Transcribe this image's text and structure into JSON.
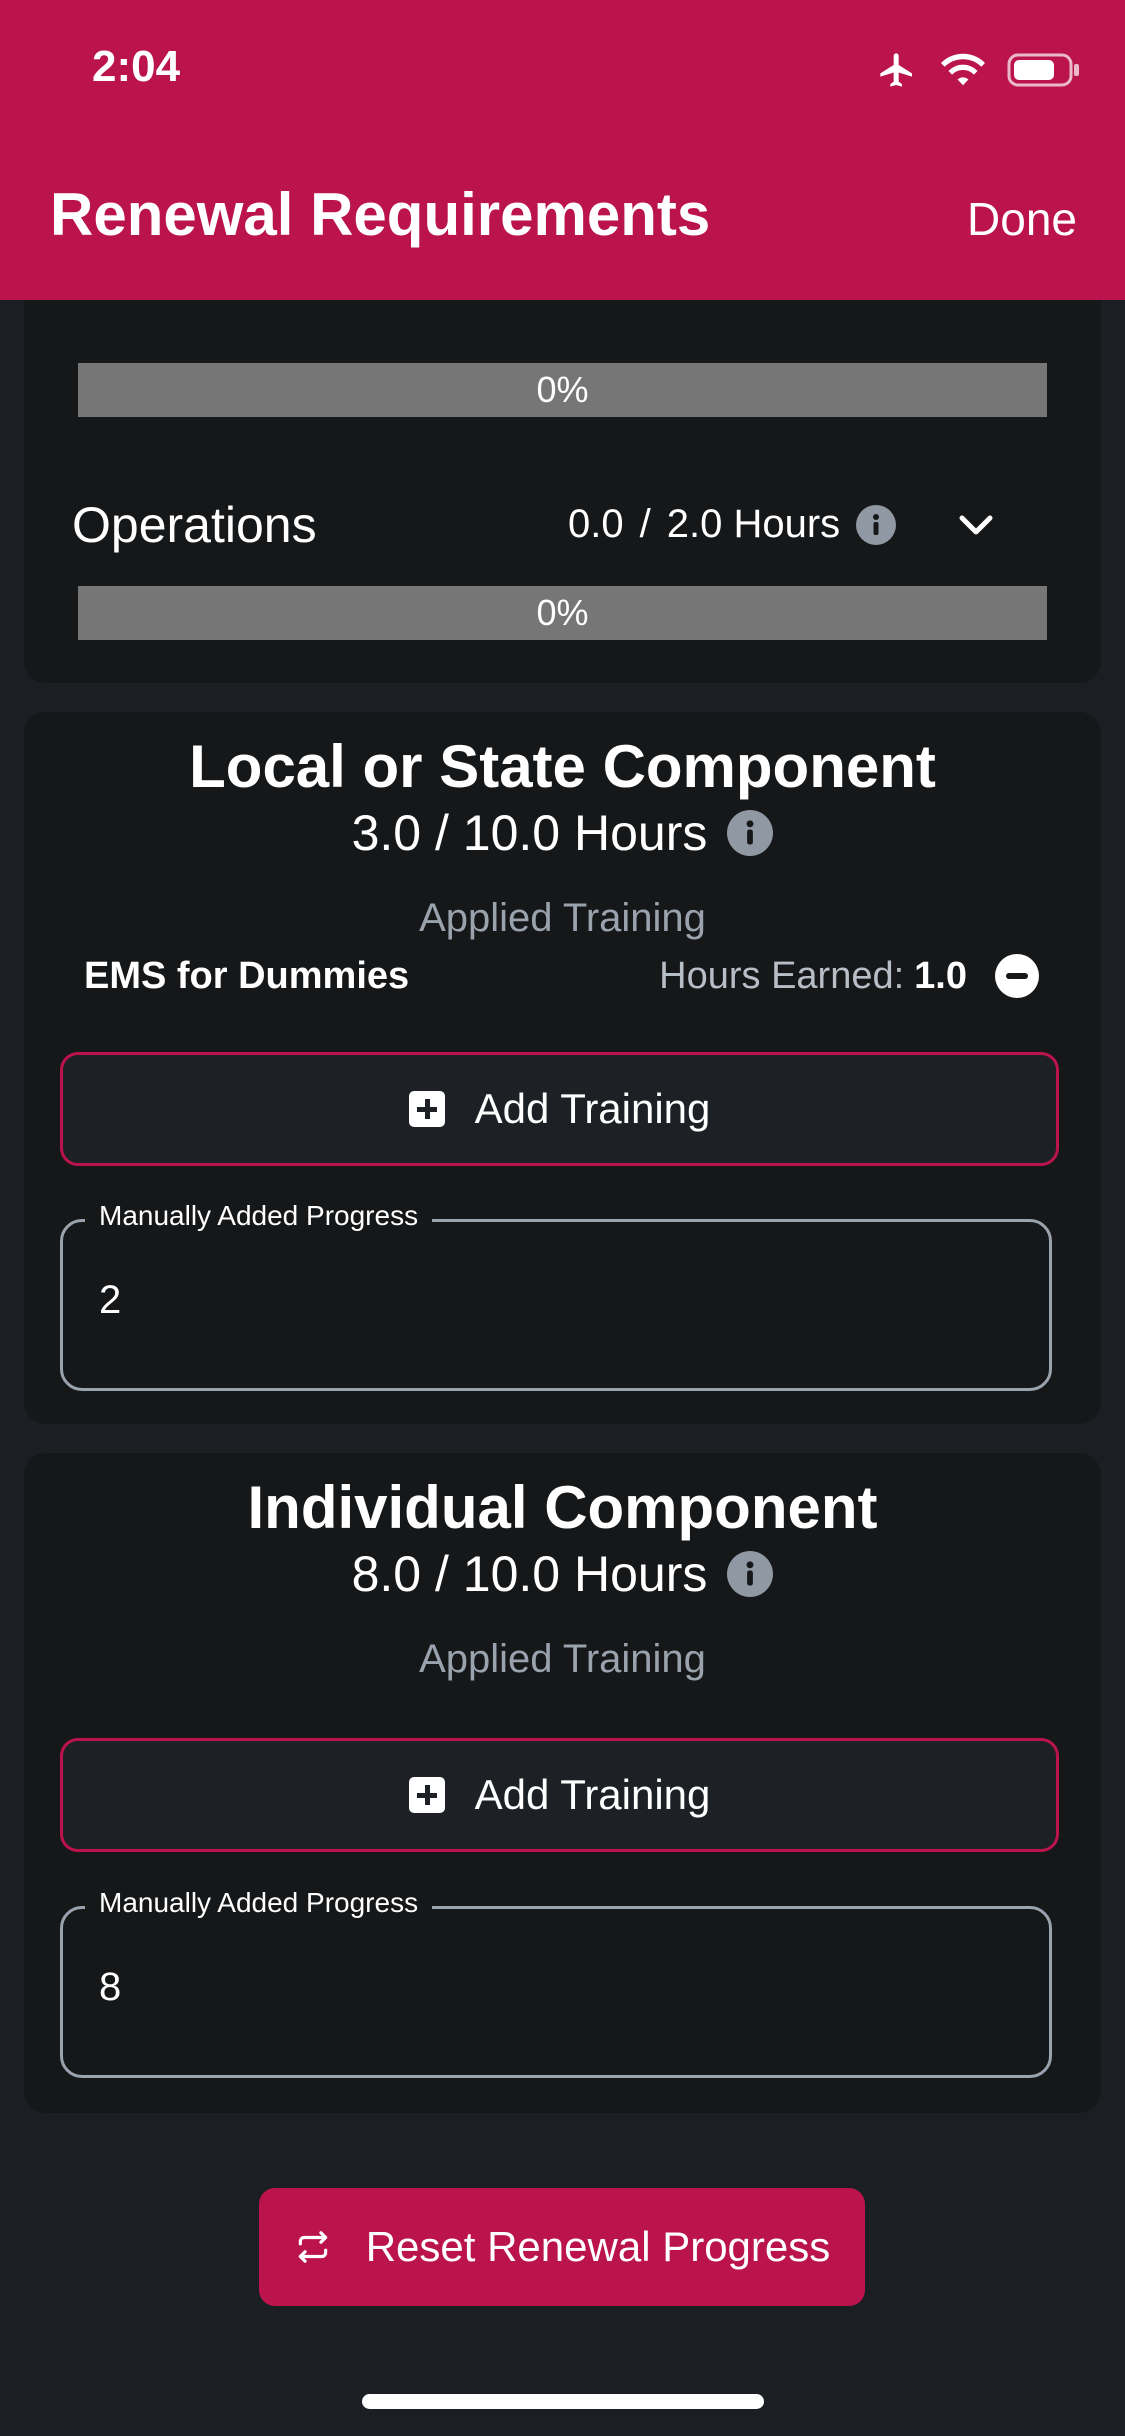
{
  "status_bar": {
    "time": "2:04"
  },
  "nav": {
    "title": "Renewal Requirements",
    "done_label": "Done"
  },
  "summary": {
    "first_bar": {
      "percent_label": "0%",
      "fraction": 0
    },
    "operations": {
      "title": "Operations",
      "earned": "0.0",
      "separator": "/",
      "required": "2.0 Hours",
      "percent_label": "0%",
      "fraction": 0
    }
  },
  "local_state": {
    "title": "Local or State Component",
    "hours": "3.0 / 10.0 Hours",
    "applied_label": "Applied Training",
    "trainings": [
      {
        "name": "EMS for Dummies",
        "hours_label": "Hours Earned:",
        "hours": "1.0"
      }
    ],
    "add_label": "Add Training",
    "manual_label": "Manually Added Progress",
    "manual_value": "2"
  },
  "individual": {
    "title": "Individual Component",
    "hours": "8.0 / 10.0 Hours",
    "applied_label": "Applied Training",
    "add_label": "Add Training",
    "manual_label": "Manually Added Progress",
    "manual_value": "8"
  },
  "reset_label": "Reset Renewal Progress",
  "colors": {
    "brand": "#bb134b",
    "background": "#1b1e22",
    "card": "#151719",
    "muted": "#9aa2ad"
  },
  "icons": [
    "airplane-icon",
    "wifi-icon",
    "battery-icon",
    "info-icon",
    "chevron-down-icon",
    "minus-circle-icon",
    "plus-box-icon",
    "repeat-icon"
  ]
}
